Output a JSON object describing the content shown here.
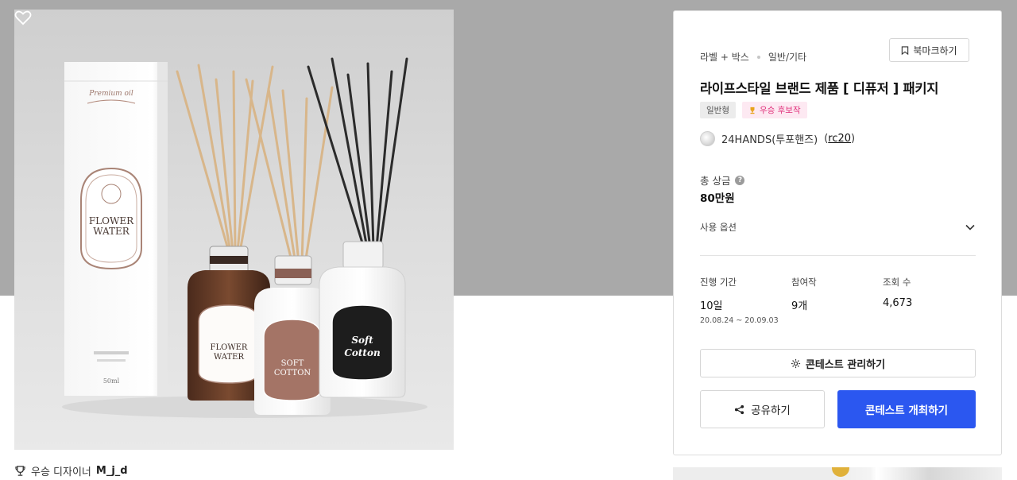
{
  "product_image": {
    "alt": "디퓨저 제품 패키지 이미지",
    "box_label_top": "Premium oil",
    "flower_label_line1": "FLOWER",
    "flower_label_line2": "WATER",
    "cotton_label_line1": "SOFT",
    "cotton_label_line2": "COTTON",
    "soft_cotton_black_line1": "Soft",
    "soft_cotton_black_line2": "Cotton",
    "box_volume": "50ml",
    "like_count": "8"
  },
  "winner": {
    "prefix": "우승 디자이너",
    "name": "M_j_d"
  },
  "card": {
    "category": "라벨 + 박스",
    "subcategory": "일반/기타",
    "bookmark_label": "북마크하기",
    "title": "라이프스타일 브랜드 제품 [ 디퓨저 ] 패키지",
    "badge_type": "일반형",
    "badge_winner": "우승 후보작",
    "author_name": "24HANDS(투포핸즈)",
    "author_handle": "rc20",
    "prize_label": "총 상금",
    "prize_value": "80만원",
    "options_label": "사용 옵션",
    "stats": [
      {
        "label": "진행 기간",
        "value": "10일",
        "sub": "20.08.24 ~ 20.09.03"
      },
      {
        "label": "참여작",
        "value": "9개",
        "sub": ""
      },
      {
        "label": "조회 수",
        "value": "4,673",
        "sub": ""
      }
    ],
    "manage_label": "콘테스트 관리하기",
    "share_label": "공유하기",
    "host_label": "콘테스트 개최하기"
  },
  "colors": {
    "accent": "#2b57f0",
    "winner_badge_text": "#e0307a",
    "winner_badge_bg": "#fde9f2",
    "header_band": "#a9a9a9"
  }
}
